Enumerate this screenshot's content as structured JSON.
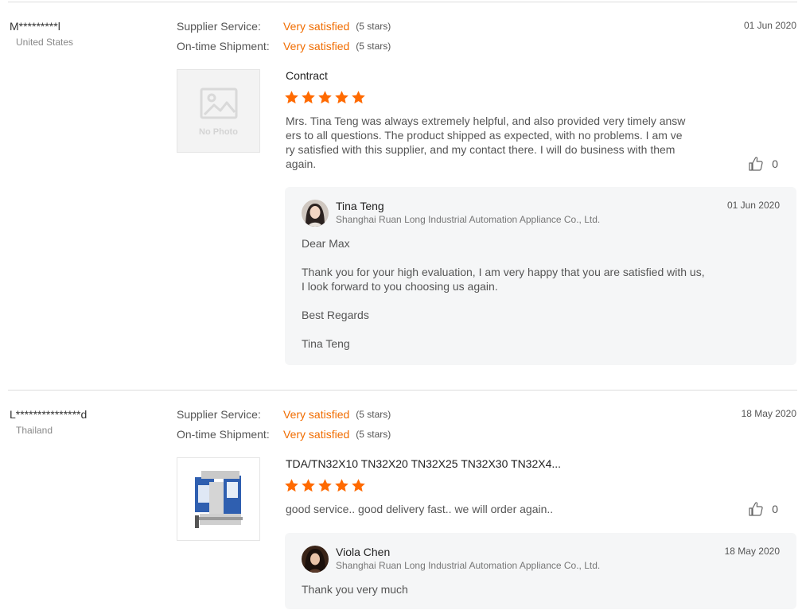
{
  "colors": {
    "accent": "#f06c00",
    "star": "#ff6a00",
    "reply_bg": "#f5f6f7"
  },
  "reviews": [
    {
      "buyer": "M*********l",
      "country": "United States",
      "date": "01 Jun 2020",
      "ratings": [
        {
          "label": "Supplier Service:",
          "value": "Very satisfied",
          "stars_text": "(5 stars)"
        },
        {
          "label": "On-time Shipment:",
          "value": "Very satisfied",
          "stars_text": "(5 stars)"
        }
      ],
      "thumbnail": {
        "type": "no-photo",
        "text": "No Photo"
      },
      "product_title": "Contract",
      "product_stars": 5,
      "text_lines": [
        "Mrs. Tina Teng was always extremely helpful, and also provided very timely answ",
        "ers to all questions.  The product shipped as expected, with no problems.  I am ve",
        "ry satisfied with this supplier, and my contact there.  I will do business with them",
        "again."
      ],
      "likes": "0",
      "reply": {
        "name": "Tina Teng",
        "company": "Shanghai Ruan Long Industrial Automation Appliance Co., Ltd.",
        "date": "01 Jun 2020",
        "lines": [
          "Dear Max",
          "Thank you for your high evaluation, I am very happy that you are satisfied with us,",
          "I look forward to you choosing us again.",
          "Best Regards",
          "Tina Teng"
        ]
      }
    },
    {
      "buyer": "L***************d",
      "country": "Thailand",
      "date": "18 May 2020",
      "ratings": [
        {
          "label": "Supplier Service:",
          "value": "Very satisfied",
          "stars_text": "(5 stars)"
        },
        {
          "label": "On-time Shipment:",
          "value": "Very satisfied",
          "stars_text": "(5 stars)"
        }
      ],
      "thumbnail": {
        "type": "product-photo"
      },
      "product_title": "TDA/TN32X10 TN32X20 TN32X25 TN32X30 TN32X4...",
      "product_stars": 5,
      "text_lines": [
        "good service.. good delivery fast.. we will order again.."
      ],
      "likes": "0",
      "reply": {
        "name": "Viola Chen",
        "company": "Shanghai Ruan Long Industrial Automation Appliance Co., Ltd.",
        "date": "18 May 2020",
        "lines": [
          "Thank you very much"
        ]
      }
    }
  ]
}
